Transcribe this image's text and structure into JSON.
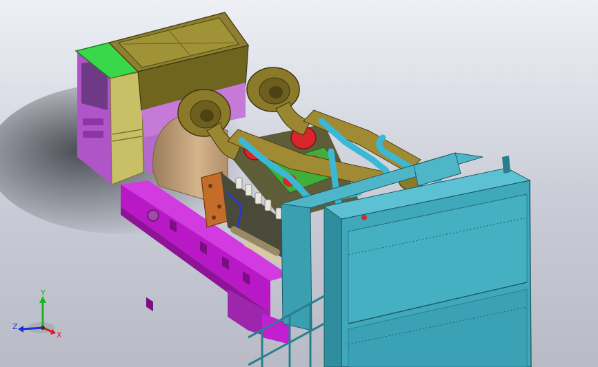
{
  "viewport": {
    "background_top": "#eef0f6",
    "background_bottom": "#b8bbc6"
  },
  "model": {
    "colors": {
      "skid": "#c21fd2",
      "skid_dark": "#8e1398",
      "enclosure_olive": "#8a7d2e",
      "enclosure_olive_dark": "#5e5418",
      "enclosure_khaki": "#bcb35a",
      "enclosure_violet": "#c47ad6",
      "green_hatch": "#39d84a",
      "alternator_tan": "#c7a37b",
      "turbo_olive": "#8b7a2a",
      "pipe_cyan": "#3bb8d6",
      "radiator_teal": "#3a9fb0",
      "radiator_dark": "#2a7f8e",
      "engine_red": "#d8262a",
      "engine_green": "#3fae3a",
      "engine_orange": "#c46d2a"
    }
  },
  "triad": {
    "x_label": "X",
    "y_label": "Y",
    "z_label": "Z",
    "x_color": "#e01a1a",
    "y_color": "#19b41f",
    "z_color": "#1a2fd6"
  }
}
